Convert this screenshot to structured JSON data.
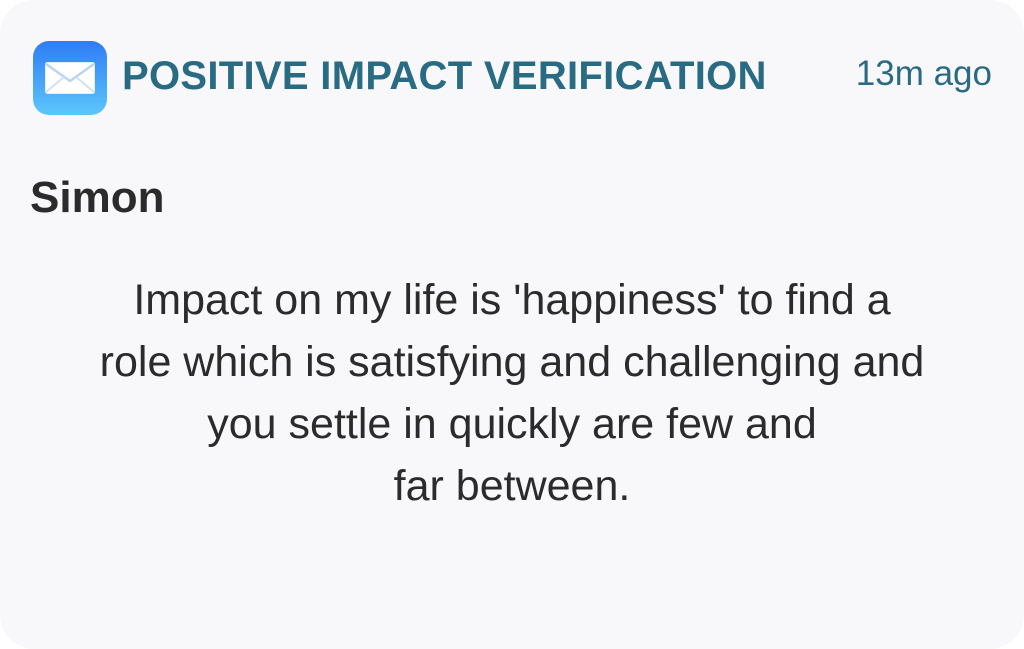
{
  "notification": {
    "app_icon": "mail-envelope-icon",
    "app_name": "POSITIVE IMPACT VERIFICATION",
    "timestamp": "13m ago",
    "sender": "Simon",
    "message_lines": [
      "Impact on my life is 'happiness' to find a",
      "role which is satisfying and challenging and",
      "you settle in quickly are few and",
      "far between."
    ]
  },
  "colors": {
    "card_background": "#f8f8fb",
    "header_text": "#2a6b84",
    "body_text": "#2b2b2b",
    "icon_gradient_top": "#2f7cf6",
    "icon_gradient_bottom": "#5cc6fb"
  }
}
